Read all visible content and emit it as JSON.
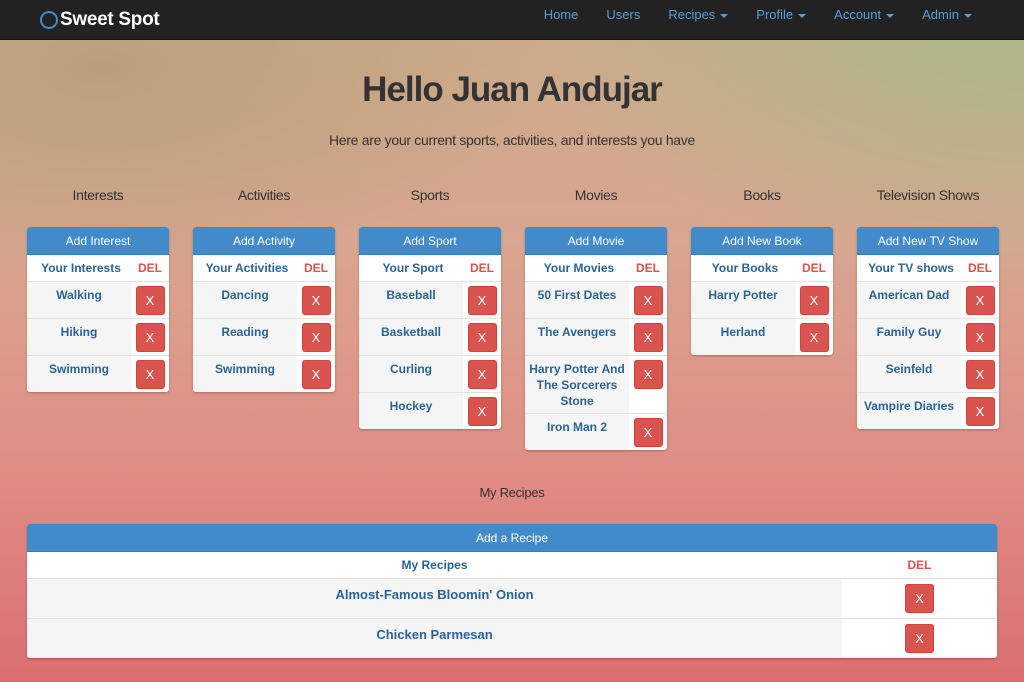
{
  "nav": {
    "brand": "Sweet Spot",
    "links": [
      {
        "label": "Home",
        "dropdown": false
      },
      {
        "label": "Users",
        "dropdown": false
      },
      {
        "label": "Recipes",
        "dropdown": true
      },
      {
        "label": "Profile",
        "dropdown": true
      },
      {
        "label": "Account",
        "dropdown": true
      },
      {
        "label": "Admin",
        "dropdown": true
      }
    ]
  },
  "title": "Hello Juan Andujar",
  "subtitle": "Here are your current sports, activities, and interests you have",
  "del_label": "DEL",
  "delete_button_label": "X",
  "categories": [
    {
      "key": "interests",
      "heading": "Interests",
      "add_label": "Add Interest",
      "list_label": "Your Interests",
      "items": [
        "Walking",
        "Hiking",
        "Swimming"
      ]
    },
    {
      "key": "activities",
      "heading": "Activities",
      "add_label": "Add Activity",
      "list_label": "Your Activities",
      "items": [
        "Dancing",
        "Reading",
        "Swimming"
      ]
    },
    {
      "key": "sports",
      "heading": "Sports",
      "add_label": "Add Sport",
      "list_label": "Your Sport",
      "items": [
        "Baseball",
        "Basketball",
        "Curling",
        "Hockey"
      ]
    },
    {
      "key": "movies",
      "heading": "Movies",
      "add_label": "Add Movie",
      "list_label": "Your Movies",
      "items": [
        "50 First Dates",
        "The Avengers",
        "Harry Potter And The Sorcerers Stone",
        "Iron Man 2"
      ]
    },
    {
      "key": "books",
      "heading": "Books",
      "add_label": "Add New Book",
      "list_label": "Your Books",
      "items": [
        "Harry Potter",
        "Herland"
      ]
    },
    {
      "key": "tv",
      "heading": "Television Shows",
      "add_label": "Add New TV Show",
      "list_label": "Your TV shows",
      "items": [
        "American Dad",
        "Family Guy",
        "Seinfeld",
        "Vampire Diaries"
      ]
    }
  ],
  "recipes": {
    "heading": "My Recipes",
    "add_label": "Add a Recipe",
    "list_label": "My Recipes",
    "items": [
      "Almost-Famous Bloomin' Onion",
      "Chicken Parmesan"
    ]
  },
  "colors": {
    "primary": "#428bca",
    "danger": "#d9534f",
    "link": "#2a6496",
    "navbar": "#222222"
  }
}
